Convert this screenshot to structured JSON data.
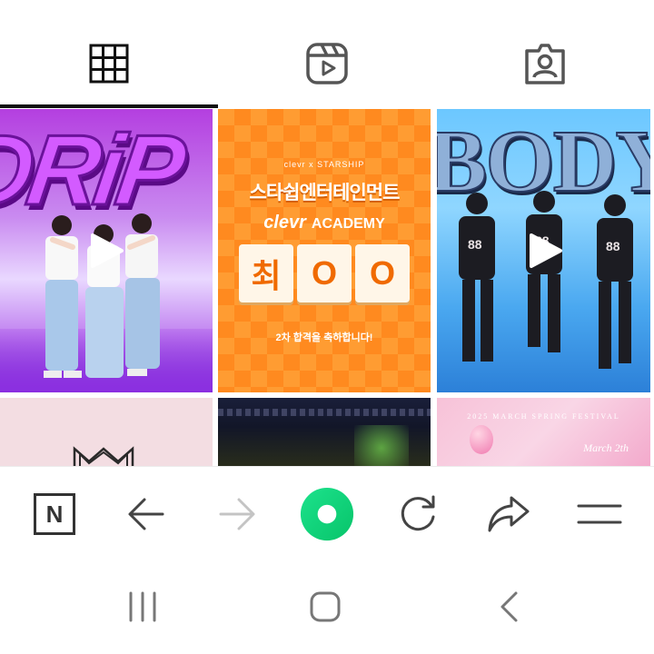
{
  "tabs": [
    {
      "icon": "grid-icon",
      "label": "Posts",
      "active": true
    },
    {
      "icon": "reels-icon",
      "label": "Reels",
      "active": false
    },
    {
      "icon": "tagged-icon",
      "label": "Tagged",
      "active": false
    }
  ],
  "grid": {
    "tile_drip": {
      "title": "DRiP",
      "type": "video"
    },
    "tile_academy": {
      "top_line": "clevr  x  STARSHIP",
      "company": "스타쉽엔터테인먼트",
      "brand_logo": "clevr",
      "brand_text": "ACADEMY",
      "boxes": [
        "최",
        "O",
        "O"
      ],
      "note": "2차 합격을 축하합니다!",
      "type": "image"
    },
    "tile_body": {
      "title": "BODY",
      "type": "video"
    },
    "tile_spring": {
      "title": "2025 MARCH SPRING FESTIVAL",
      "date": "March 2th"
    }
  },
  "toolbar": [
    {
      "icon": "naver-home-icon",
      "label": "N"
    },
    {
      "icon": "back-arrow-icon"
    },
    {
      "icon": "forward-arrow-icon",
      "enabled": false
    },
    {
      "icon": "naver-green-dot-icon"
    },
    {
      "icon": "refresh-icon"
    },
    {
      "icon": "share-icon"
    },
    {
      "icon": "menu-icon"
    }
  ],
  "system_nav": [
    {
      "icon": "recent-apps-icon"
    },
    {
      "icon": "home-icon"
    },
    {
      "icon": "back-icon"
    }
  ],
  "colors": {
    "accent_green": "#12d27a",
    "tab_indicator": "#111111",
    "icon_gray": "#555555",
    "disabled_gray": "#c4c4c4"
  }
}
